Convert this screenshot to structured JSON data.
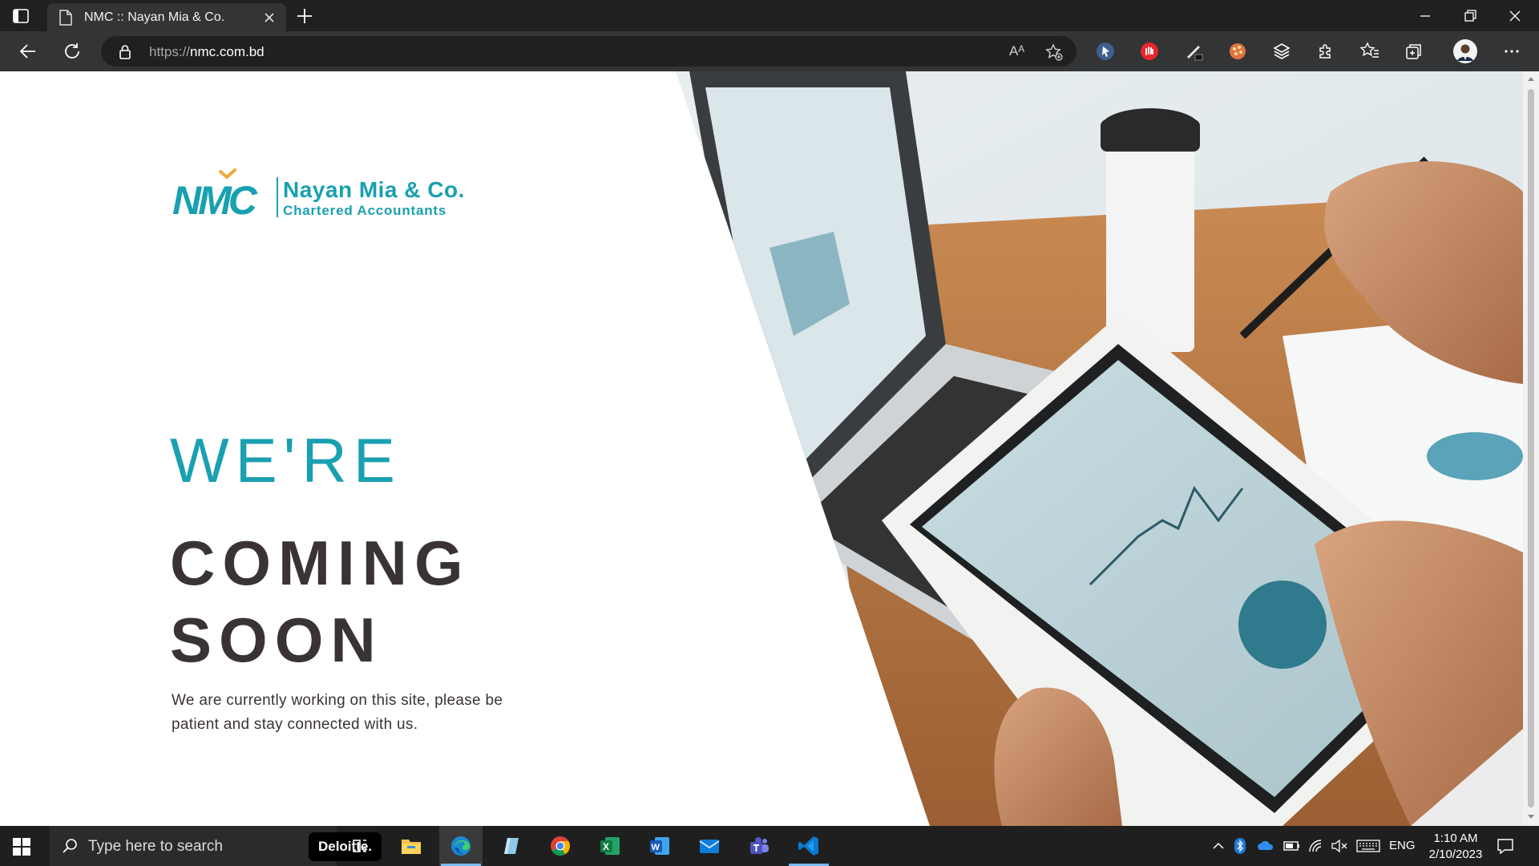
{
  "browser": {
    "tab_title": "NMC :: Nayan Mia & Co.",
    "url_protocol": "https://",
    "url_host": "nmc.com.bd",
    "read_aloud_label": "Aᴬ"
  },
  "page": {
    "logo": {
      "mark_text": "NMC",
      "company_name": "Nayan Mia & Co.",
      "tagline": "Chartered Accountants"
    },
    "hero": {
      "line1": "WE'RE",
      "line2": "COMING",
      "line3": "SOON",
      "description": "We are currently working on this site, please be patient and stay connected with us."
    },
    "colors": {
      "brand_teal": "#19a0b1",
      "heading_dark": "#3a3335"
    }
  },
  "taskbar": {
    "search_placeholder": "Type here to search",
    "deloitte_label": "Deloitte.",
    "excel_letter": "X",
    "word_letter": "W",
    "language": "ENG",
    "time": "1:10 AM",
    "date": "2/10/2023",
    "apps": [
      "task-view",
      "file-explorer",
      "edge",
      "notepad-plus",
      "chrome",
      "excel",
      "word",
      "mail",
      "teams",
      "vscode"
    ]
  }
}
